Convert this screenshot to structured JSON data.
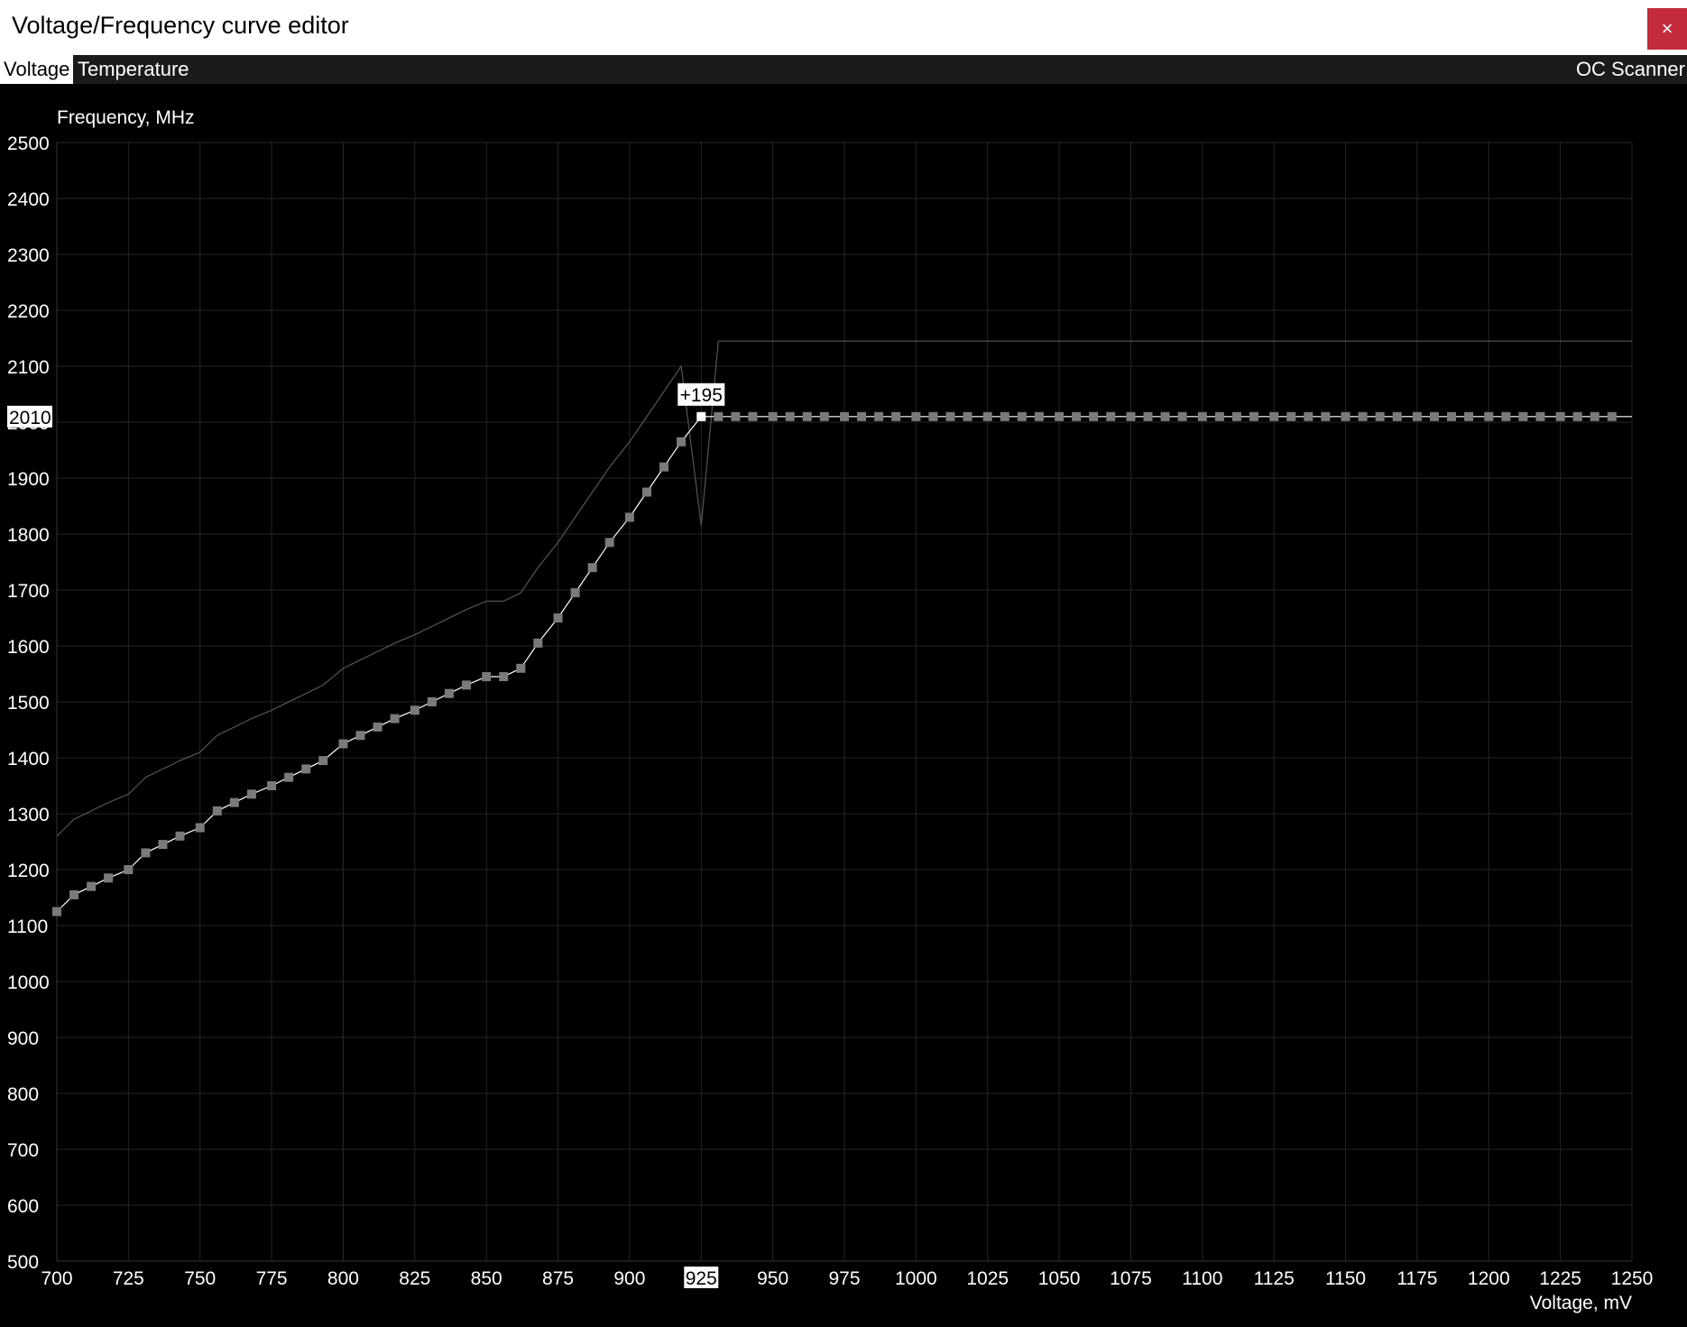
{
  "window": {
    "title": "Voltage/Frequency curve editor",
    "close_label": "×",
    "close_color": "#c42b3b"
  },
  "tabs": [
    {
      "label": "Voltage",
      "selected": true
    },
    {
      "label": "Temperature",
      "selected": false
    }
  ],
  "oc_scanner_label": "OC Scanner",
  "chart_data": {
    "type": "line",
    "ylabel": "Frequency, MHz",
    "xlabel": "Voltage, mV",
    "xlim": [
      700,
      1250
    ],
    "ylim": [
      500,
      2500
    ],
    "grid": true,
    "x_ticks": [
      "700",
      "725",
      "750",
      "775",
      "800",
      "825",
      "850",
      "875",
      "900",
      "925",
      "950",
      "975",
      "1000",
      "1025",
      "1050",
      "1075",
      "1100",
      "1125",
      "1150",
      "1175",
      "1200",
      "1225",
      "1250"
    ],
    "y_ticks": [
      "500",
      "600",
      "700",
      "800",
      "900",
      "1000",
      "1100",
      "1200",
      "1300",
      "1400",
      "1500",
      "1600",
      "1700",
      "1800",
      "1900",
      "2000",
      "2100",
      "2200",
      "2300",
      "2400",
      "2500"
    ],
    "selected_point": {
      "x": 925,
      "y": 2010,
      "x_label": "925",
      "y_label": "2010",
      "offset_label": "+195"
    },
    "series": [
      {
        "role": "default curve",
        "color": "#505050",
        "x": [
          700,
          706,
          712,
          718,
          725,
          731,
          737,
          743,
          750,
          756,
          762,
          768,
          775,
          781,
          787,
          793,
          800,
          806,
          812,
          818,
          825,
          831,
          837,
          843,
          850,
          856,
          862,
          868,
          875,
          881,
          887,
          893,
          900,
          906,
          912,
          918,
          925,
          931,
          1250
        ],
        "y": [
          1260,
          1290,
          1305,
          1320,
          1335,
          1365,
          1380,
          1395,
          1410,
          1440,
          1455,
          1470,
          1485,
          1500,
          1515,
          1530,
          1560,
          1575,
          1590,
          1605,
          1620,
          1635,
          1650,
          1665,
          1680,
          1680,
          1695,
          1740,
          1785,
          1830,
          1875,
          1920,
          1965,
          2010,
          2055,
          2100,
          1815,
          2145,
          2145
        ]
      },
      {
        "role": "current curve",
        "color": "#ffffff",
        "point_color": "#7a7a7a",
        "x": [
          700,
          706,
          712,
          718,
          725,
          731,
          737,
          743,
          750,
          756,
          762,
          768,
          775,
          781,
          787,
          793,
          800,
          806,
          812,
          818,
          825,
          831,
          837,
          843,
          850,
          856,
          862,
          868,
          875,
          881,
          887,
          893,
          900,
          906,
          912,
          918,
          925,
          931,
          937,
          943,
          950,
          956,
          962,
          968,
          975,
          981,
          987,
          993,
          1000,
          1006,
          1012,
          1018,
          1025,
          1031,
          1037,
          1043,
          1050,
          1056,
          1062,
          1068,
          1075,
          1081,
          1087,
          1093,
          1100,
          1106,
          1112,
          1118,
          1125,
          1131,
          1137,
          1143,
          1150,
          1156,
          1162,
          1168,
          1175,
          1181,
          1187,
          1193,
          1200,
          1206,
          1212,
          1218,
          1225,
          1231,
          1237,
          1243
        ],
        "y": [
          1125,
          1155,
          1170,
          1185,
          1200,
          1230,
          1245,
          1260,
          1275,
          1305,
          1320,
          1335,
          1350,
          1365,
          1380,
          1395,
          1425,
          1440,
          1455,
          1470,
          1485,
          1500,
          1515,
          1530,
          1545,
          1545,
          1560,
          1605,
          1650,
          1695,
          1740,
          1785,
          1830,
          1875,
          1920,
          1965,
          2010,
          2010,
          2010,
          2010,
          2010,
          2010,
          2010,
          2010,
          2010,
          2010,
          2010,
          2010,
          2010,
          2010,
          2010,
          2010,
          2010,
          2010,
          2010,
          2010,
          2010,
          2010,
          2010,
          2010,
          2010,
          2010,
          2010,
          2010,
          2010,
          2010,
          2010,
          2010,
          2010,
          2010,
          2010,
          2010,
          2010,
          2010,
          2010,
          2010,
          2010,
          2010,
          2010,
          2010,
          2010,
          2010,
          2010,
          2010,
          2010,
          2010,
          2010,
          2010
        ]
      }
    ]
  }
}
